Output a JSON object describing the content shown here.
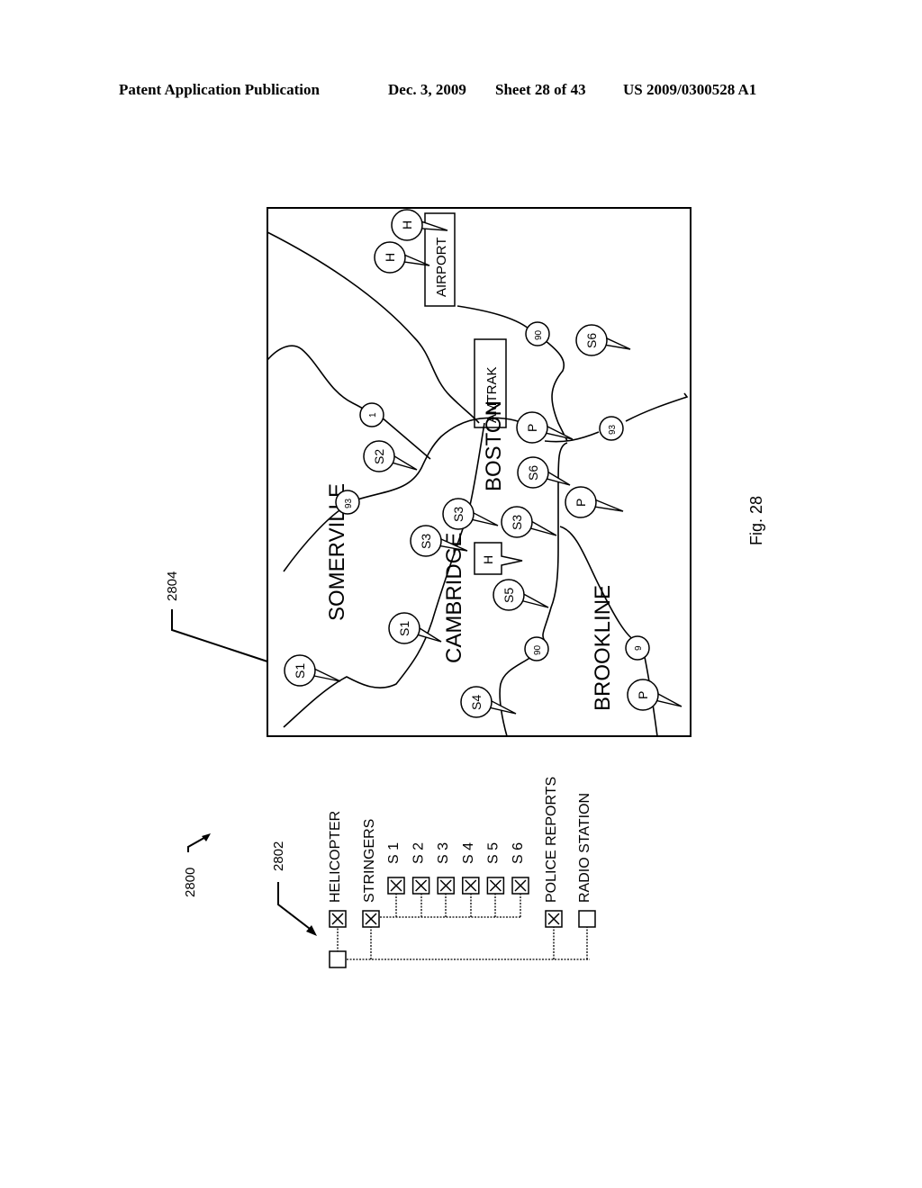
{
  "header": {
    "publication_type": "Patent Application Publication",
    "date": "Dec. 3, 2009",
    "sheet": "Sheet 28 of 43",
    "pub_number": "US 2009/0300528 A1"
  },
  "figure": {
    "caption": "Fig. 28",
    "ref_system": "2800",
    "ref_legend": "2802",
    "ref_map": "2804"
  },
  "legend": {
    "root_checked": false,
    "items": [
      {
        "label": "HELICOPTER",
        "checked": true
      },
      {
        "label": "STRINGERS",
        "checked": true
      },
      {
        "label": "POLICE REPORTS",
        "checked": true
      },
      {
        "label": "RADIO STATION",
        "checked": false
      }
    ],
    "stringers": [
      {
        "label": "S 1",
        "checked": true
      },
      {
        "label": "S 2",
        "checked": true
      },
      {
        "label": "S 3",
        "checked": true
      },
      {
        "label": "S 4",
        "checked": true
      },
      {
        "label": "S 5",
        "checked": true
      },
      {
        "label": "S 6",
        "checked": true
      }
    ]
  },
  "map": {
    "regions": [
      "SOMERVILLE",
      "CAMBRIDGE",
      "BOSTON",
      "BROOKLINE"
    ],
    "landmarks": [
      "AIRPORT",
      "AMTRAK"
    ],
    "highways": [
      "1",
      "93",
      "90",
      "93",
      "90",
      "9"
    ],
    "markers": [
      "H",
      "H",
      "H",
      "S1",
      "S1",
      "S2",
      "S3",
      "S3",
      "S3",
      "S4",
      "S5",
      "S6",
      "S6",
      "P",
      "P",
      "P"
    ]
  }
}
